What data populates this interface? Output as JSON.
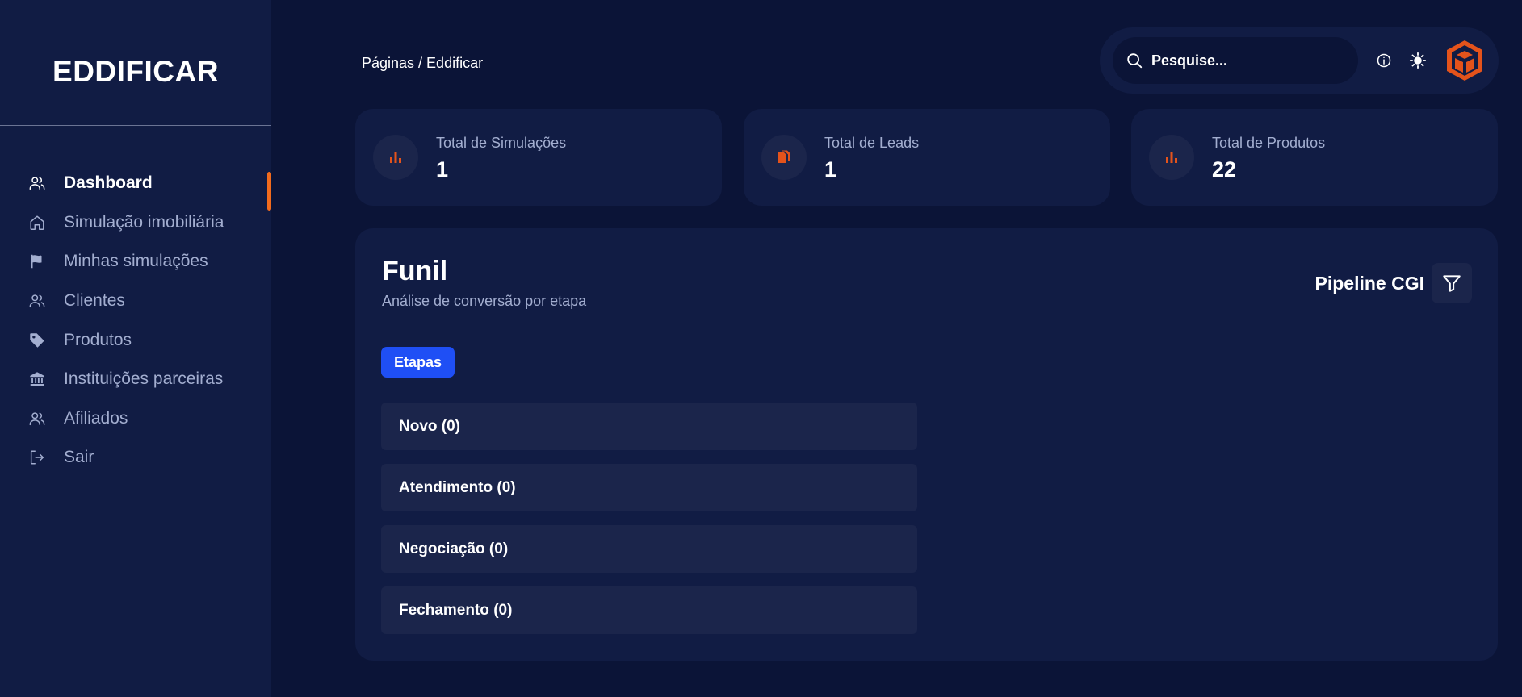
{
  "sidebar": {
    "brand": "EDDIFICAR",
    "items": [
      {
        "label": "Dashboard",
        "icon": "users-icon"
      },
      {
        "label": "Simulação imobiliária",
        "icon": "home-icon"
      },
      {
        "label": "Minhas simulações",
        "icon": "flag-icon"
      },
      {
        "label": "Clientes",
        "icon": "users-icon"
      },
      {
        "label": "Produtos",
        "icon": "tag-icon"
      },
      {
        "label": "Instituições parceiras",
        "icon": "bank-icon"
      },
      {
        "label": "Afiliados",
        "icon": "users-icon"
      },
      {
        "label": "Sair",
        "icon": "logout-icon"
      }
    ],
    "active_index": 0
  },
  "header": {
    "breadcrumb": "Páginas / Eddificar",
    "search_placeholder": "Pesquise..."
  },
  "stats": [
    {
      "label": "Total de Simulações",
      "value": "1",
      "icon": "bar-chart-icon"
    },
    {
      "label": "Total de Leads",
      "value": "1",
      "icon": "documents-icon"
    },
    {
      "label": "Total de Produtos",
      "value": "22",
      "icon": "bar-chart-icon"
    }
  ],
  "funnel": {
    "title": "Funil",
    "subtitle": "Análise de conversão por etapa",
    "pipeline": "Pipeline CGI",
    "tab": "Etapas",
    "stages": [
      "Novo (0)",
      "Atendimento (0)",
      "Negociação (0)",
      "Fechamento (0)"
    ]
  },
  "colors": {
    "background": "#0b1437",
    "card": "#111c44",
    "accent": "#f26b1d",
    "primary": "#1f4ff5",
    "muted_text": "#a3aed0"
  }
}
